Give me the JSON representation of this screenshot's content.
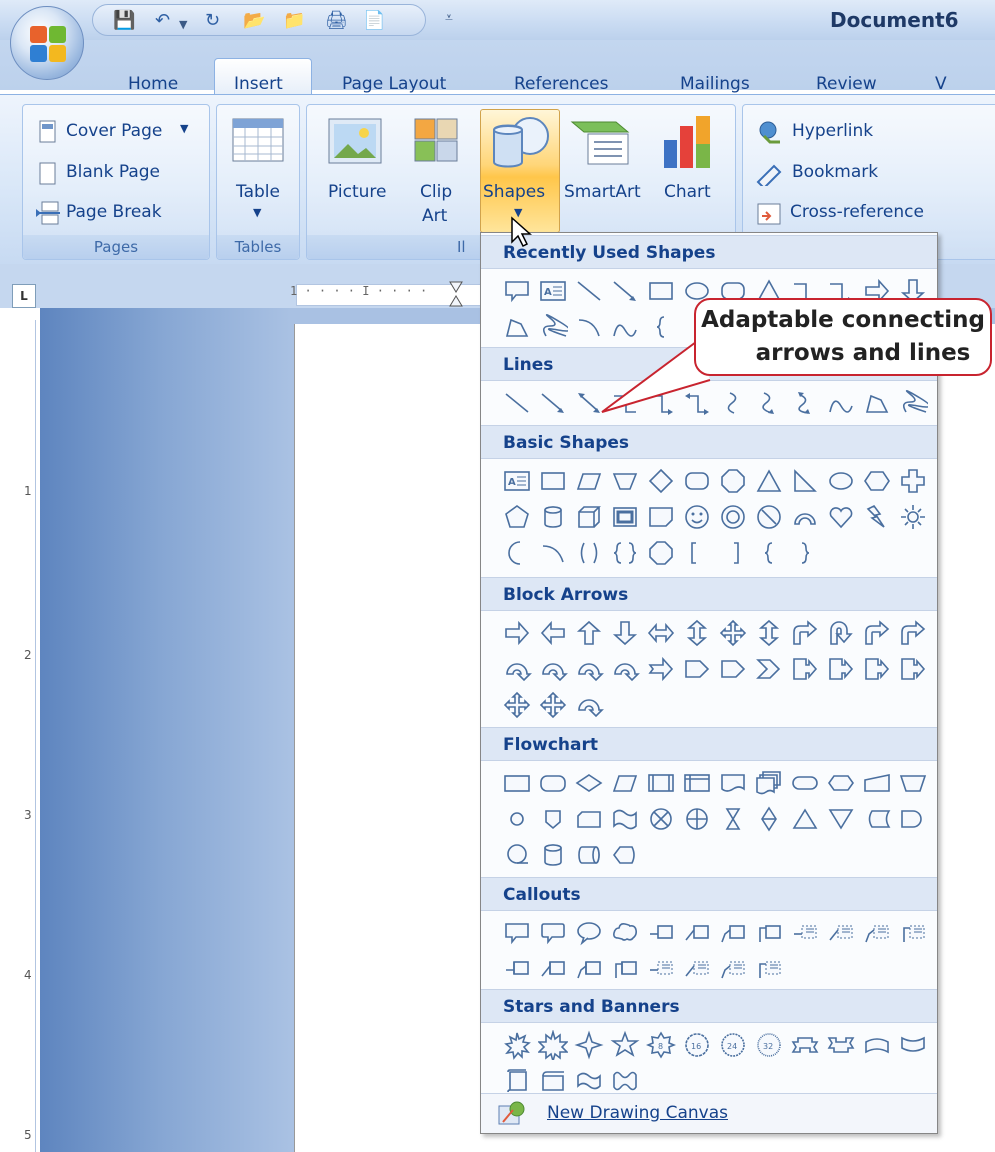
{
  "window": {
    "title": "Document6"
  },
  "tabs": [
    {
      "label": "Home",
      "active": false
    },
    {
      "label": "Insert",
      "active": true
    },
    {
      "label": "Page Layout",
      "active": false
    },
    {
      "label": "References",
      "active": false
    },
    {
      "label": "Mailings",
      "active": false
    },
    {
      "label": "Review",
      "active": false
    },
    {
      "label": "V",
      "active": false
    }
  ],
  "ribbon": {
    "pages": {
      "label": "Pages",
      "cover_page": "Cover Page",
      "blank_page": "Blank Page",
      "page_break": "Page Break"
    },
    "tables": {
      "label": "Tables",
      "table": "Table"
    },
    "illustrations": {
      "label": "Il",
      "picture": "Picture",
      "clip_art_1": "Clip",
      "clip_art_2": "Art",
      "shapes": "Shapes",
      "smartart": "SmartArt",
      "chart": "Chart"
    },
    "links": {
      "hyperlink": "Hyperlink",
      "bookmark": "Bookmark",
      "cross_reference": "Cross-reference"
    }
  },
  "ruler": {
    "h_marker": "1 · · · · I · · · ·",
    "v_marks": [
      "1",
      "2",
      "3",
      "4",
      "5"
    ]
  },
  "shapes_menu": {
    "sections": [
      {
        "key": "recent",
        "title": "Recently Used Shapes"
      },
      {
        "key": "lines",
        "title": "Lines"
      },
      {
        "key": "basic",
        "title": "Basic Shapes"
      },
      {
        "key": "block",
        "title": "Block Arrows"
      },
      {
        "key": "flow",
        "title": "Flowchart"
      },
      {
        "key": "callouts",
        "title": "Callouts"
      },
      {
        "key": "stars",
        "title": "Stars and Banners"
      }
    ],
    "new_canvas": "New Drawing Canvas"
  },
  "callout": {
    "line1": "Adaptable connecting",
    "line2": "arrows and lines"
  },
  "colors": {
    "accent": "#15428b",
    "callout_border": "#c8242f",
    "highlight": "#ffd679"
  }
}
